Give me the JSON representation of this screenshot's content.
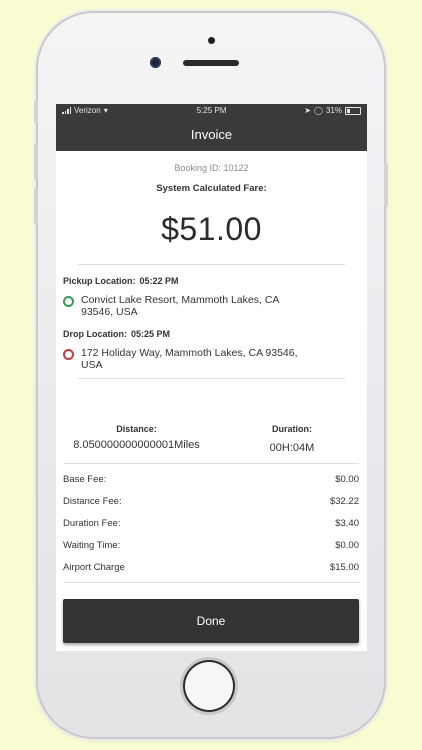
{
  "status_bar": {
    "carrier": "Verizon",
    "time": "5:25 PM",
    "battery": "31%"
  },
  "nav": {
    "title": "Invoice"
  },
  "booking": {
    "id_label": "Booking ID: 10122",
    "fare_label": "System Calculated Fare:",
    "fare_amount": "$51.00"
  },
  "pickup": {
    "label": "Pickup Location:",
    "time": "05:22 PM",
    "address": "Convict Lake Resort, Mammoth Lakes, CA 93546, USA"
  },
  "drop": {
    "label": "Drop Location:",
    "time": "05:25 PM",
    "address": "172 Holiday Way, Mammoth Lakes, CA 93546, USA"
  },
  "stats": {
    "distance_label": "Distance:",
    "distance_value": "8.050000000000001Miles",
    "duration_label": "Duration:",
    "duration_value": "00H:04M"
  },
  "fees": [
    {
      "label": "Base Fee:",
      "value": "$0.00"
    },
    {
      "label": "Distance Fee:",
      "value": "$32.22"
    },
    {
      "label": "Duration Fee:",
      "value": "$3.40"
    },
    {
      "label": "Waiting Time:",
      "value": "$0.00"
    },
    {
      "label": "Airport Charge",
      "value": "$15.00"
    }
  ],
  "actions": {
    "done_label": "Done"
  },
  "colors": {
    "background": "#fbfbd2",
    "header": "#3a3a3a",
    "pickup_dot": "#3a9a5b",
    "drop_dot": "#c43a3a",
    "button": "#333333"
  }
}
